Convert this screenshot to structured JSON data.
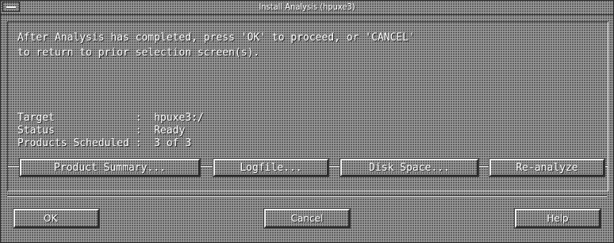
{
  "window": {
    "title": "Install Analysis (hpuxe3)"
  },
  "message": {
    "line1": "After Analysis has completed, press 'OK' to proceed, or 'CANCEL'",
    "line2": "to return to prior selection screen(s)."
  },
  "info": {
    "target": "Target             :  hpuxe3:/",
    "status": "Status             :  Ready",
    "products": "Products Scheduled :  3 of 3"
  },
  "actions": {
    "product_summary": "Product Summary...",
    "logfile": "Logfile...",
    "disk_space": "Disk Space...",
    "reanalyze": "Re-analyze"
  },
  "footer": {
    "ok": "OK",
    "cancel": "Cancel",
    "help": "Help"
  },
  "colors": {
    "background": "#9c9c9c",
    "text": "#ffffff"
  }
}
